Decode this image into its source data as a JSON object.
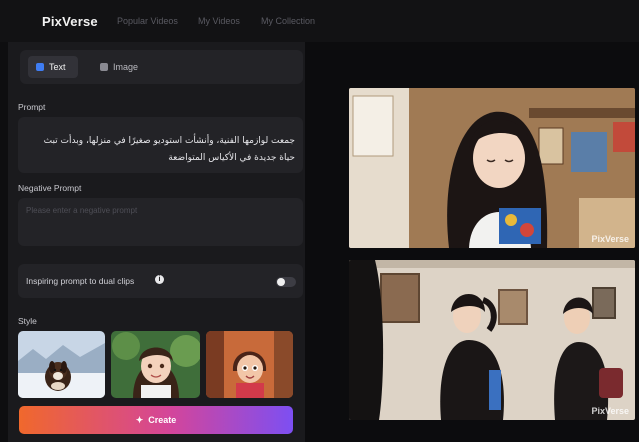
{
  "app": {
    "logo": "PixVerse"
  },
  "nav": {
    "items": [
      "Popular Videos",
      "My Videos",
      "My Collection"
    ]
  },
  "tabs": {
    "text_label": "Text",
    "image_label": "Image",
    "active": "Text"
  },
  "prompt": {
    "label": "Prompt",
    "value": "جمعت لوازمها الفنية، وأنشأت استوديو صغيرًا في منزلها، وبدأت تبث حياة جديدة في الأكياس المتواضعة"
  },
  "negative_prompt": {
    "label": "Negative Prompt",
    "placeholder": "Please enter a negative prompt"
  },
  "dual_clips": {
    "label": "Inspiring prompt to dual clips",
    "enabled": false
  },
  "style": {
    "label": "Style",
    "options": [
      "dog-snow-style",
      "anime-girl-style",
      "cartoon-kid-style"
    ]
  },
  "create_button": {
    "label": "Create"
  },
  "videos": {
    "watermark": "PixVerse"
  },
  "colors": {
    "accent_start": "#f0682c",
    "accent_mid": "#d4459a",
    "accent_end": "#7d4ff2",
    "tab_text_icon": "#3f7df3",
    "panel": "#1a1a1d"
  }
}
